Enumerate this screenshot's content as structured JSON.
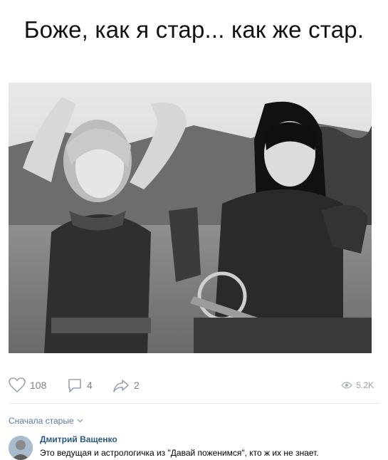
{
  "post": {
    "caption": "Боже, как я стар... как же стар.",
    "image_alt": "two women in warrior costumes, black and white photo"
  },
  "actions": {
    "likes": "108",
    "comments": "4",
    "shares": "2",
    "views": "5.2K"
  },
  "comments_section": {
    "sort_label": "Сначала старые",
    "items": [
      {
        "author": "Дмитрий Ващенко",
        "text": "Это ведущая и астрологичка из \"Давай поженимся\", кто ж их не знает."
      }
    ]
  },
  "colors": {
    "link": "#2a5885",
    "muted": "#828282",
    "sort": "#5a7aa6"
  }
}
